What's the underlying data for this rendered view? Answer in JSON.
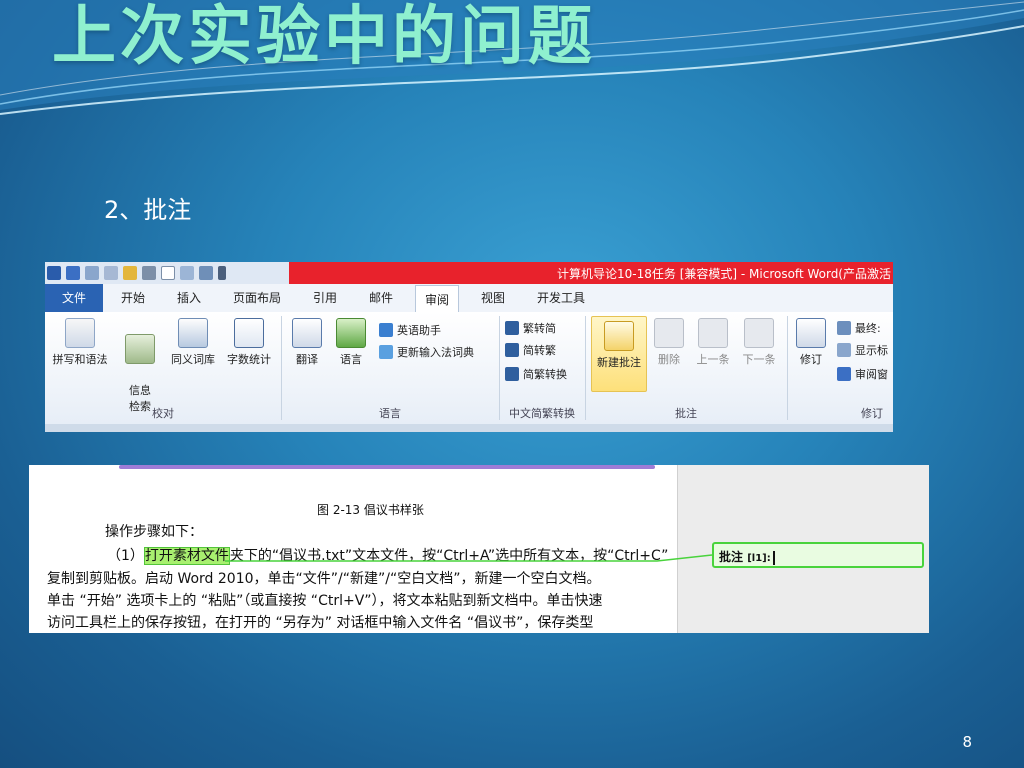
{
  "slide": {
    "title": "上次实验中的问题",
    "subtitle": "2、批注",
    "page_number": "8"
  },
  "ribbon": {
    "window_title": "计算机导论10-18任务 [兼容模式] - Microsoft Word(产品激活",
    "tabs": [
      "文件",
      "开始",
      "插入",
      "页面布局",
      "引用",
      "邮件",
      "审阅",
      "视图",
      "开发工具"
    ],
    "active_tab": "审阅",
    "groups": {
      "proofing": {
        "label": "校对",
        "buttons": [
          "拼写和语法",
          "信息\n检索",
          "同义词库",
          "字数统计"
        ]
      },
      "language": {
        "label": "语言",
        "buttons": [
          "翻译",
          "语言"
        ],
        "small": [
          "英语助手",
          "更新输入法词典"
        ]
      },
      "chinese_conversion": {
        "label": "中文简繁转换",
        "small": [
          "繁转简",
          "简转繁",
          "简繁转换"
        ]
      },
      "comments": {
        "label": "批注",
        "buttons": [
          "新建批注",
          "删除",
          "上一条",
          "下一条"
        ]
      },
      "tracking": {
        "label": "修订",
        "buttons": [
          "修订"
        ],
        "small": [
          "最终:",
          "显示标",
          "审阅窗"
        ]
      }
    }
  },
  "document": {
    "figure_caption": "图 2-13 倡议书样张",
    "lines": [
      "操作步骤如下：",
      "（1）",
      "打开素材文件",
      "夹下的“倡议书.txt”文本文件，按“Ctrl+A”选中所有文本，按“Ctrl+C”",
      "复制到剪贴板。启动 Word 2010，单击“文件”/“新建”/“空白文档”，新建一个空白文档。",
      "单击 “开始” 选项卡上的 “粘贴”（或直接按 “Ctrl+V”），将文本粘贴到新文档中。单击快速",
      "访问工具栏上的保存按钮，在打开的 “另存为” 对话框中输入文件名 “倡议书”，保存类型"
    ],
    "comment_label": "批注",
    "comment_ref": "[l1]:"
  }
}
